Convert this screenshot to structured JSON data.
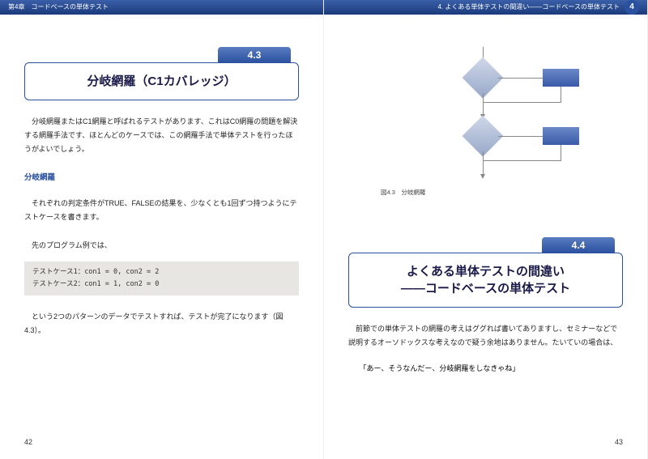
{
  "header": {
    "left": "第4章　コードベースの単体テスト",
    "right": "4. よくある単体テストの間違い――コードベースの単体テスト",
    "chapter_badge": "4"
  },
  "section43": {
    "num": "4.3",
    "title": "分岐網羅（C1カバレッジ）",
    "para1": "分岐網羅またはC1網羅と呼ばれるテストがあります、これはC0網羅の問題を解決する網羅手法です、ほとんどのケースでは、この網羅手法で単体テストを行ったほうがよいでしょう。",
    "subheading": "分岐網羅",
    "para2": "それぞれの判定条件がTRUE、FALSEの結果を、少なくとも1回ずつ持つようにテストケースを書きます。",
    "para3": "先のプログラム例では、",
    "code_line1": "テストケース1：con1 = 0, con2 = 2",
    "code_line2": "テストケース2：con1 = 1, con2 = 0",
    "para4": "という2つのパターンのデータでテストすれば、テストが完了になります（図4.3）。"
  },
  "figure": {
    "caption": "図4.3　分岐網羅"
  },
  "section44": {
    "num": "4.4",
    "title_line1": "よくある単体テストの間違い",
    "title_line2": "――コードベースの単体テスト",
    "para1": "前節での単体テストの網羅の考えはググれば書いてありますし、セミナーなどで説明するオーソドックスな考えなので疑う余地はありません。たいていの場合は、",
    "quote": "「あー、そうなんだー、分岐網羅をしなきゃね」"
  },
  "page_left": "42",
  "page_right": "43"
}
